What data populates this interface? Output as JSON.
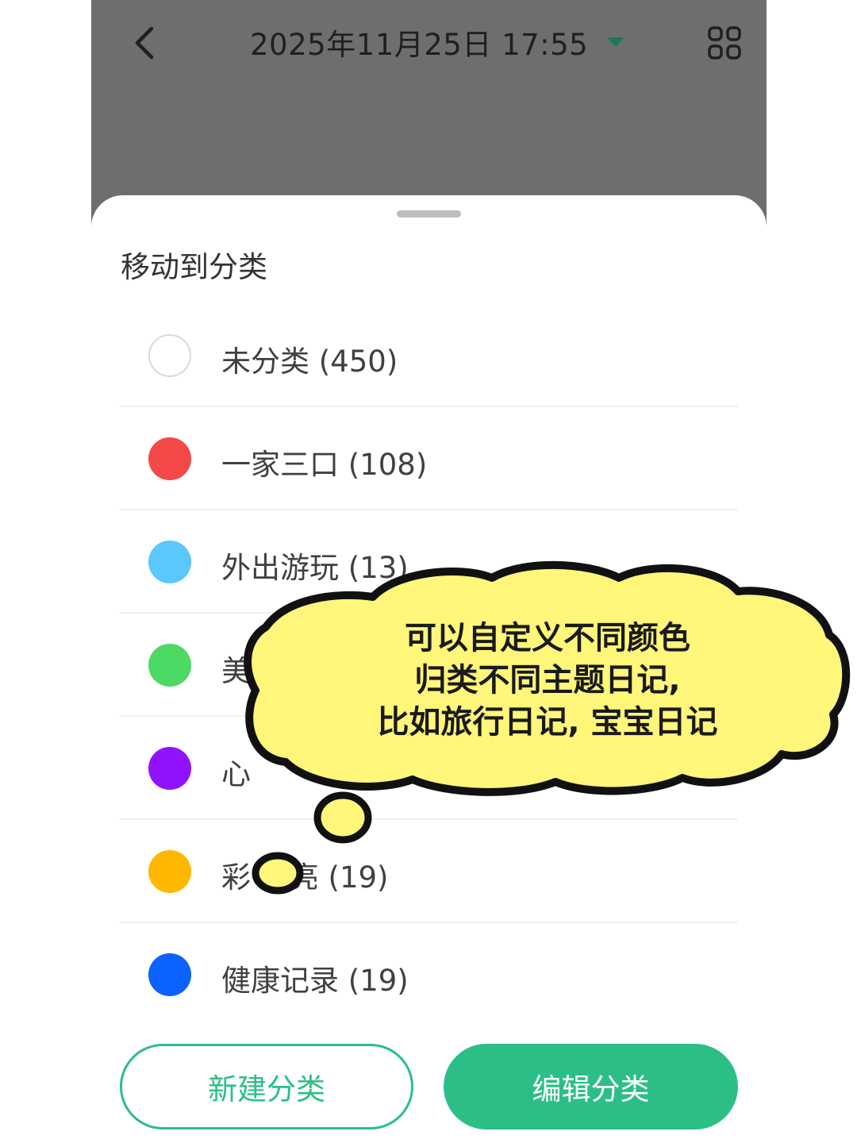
{
  "header": {
    "title": "2025年11月25日 17:55"
  },
  "sheet": {
    "title": "移动到分类"
  },
  "categories": [
    {
      "label": "未分类 (450)",
      "color": ""
    },
    {
      "label": "一家三口 (108)",
      "color": "#f54848"
    },
    {
      "label": "外出游玩 (13)",
      "color": "#5ac8fa"
    },
    {
      "label": "美",
      "color": "#4cd964"
    },
    {
      "label": "心",
      "color": "#9013fe"
    },
    {
      "label": "彩 亮亮 (19)",
      "color": "#ffb800"
    },
    {
      "label": "健康记录 (19)",
      "color": "#0a63ff"
    }
  ],
  "buttons": {
    "new_label": "新建分类",
    "edit_label": "编辑分类"
  },
  "annotation": {
    "lines": [
      "可以自定义不同颜色",
      "归类不同主题日记,",
      "比如旅行日记, 宝宝日记"
    ],
    "cloud_color": "#fff67a"
  },
  "colors": {
    "accent": "#2bbf86",
    "header_bg": "#6e6e6e"
  },
  "icons": {
    "back": "chevron-left-icon",
    "dropdown": "caret-down-icon",
    "grid": "grid-icon"
  }
}
